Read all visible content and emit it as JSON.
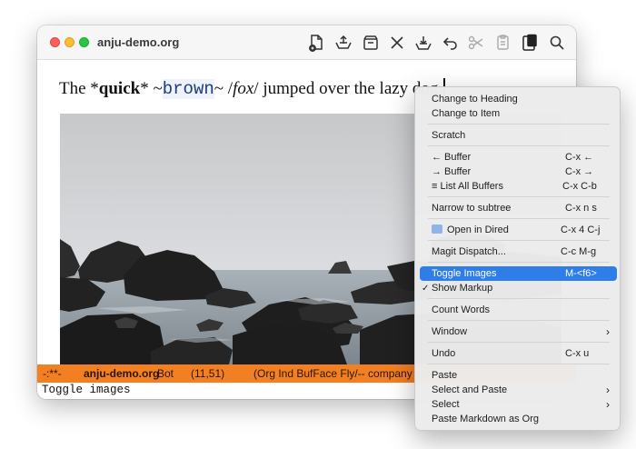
{
  "window": {
    "title": "anju-demo.org"
  },
  "toolbar": {
    "icons": [
      "new-file-icon",
      "upload-icon",
      "inbox-icon",
      "close-icon",
      "save-icon",
      "undo-icon",
      "cut-icon",
      "copy-icon",
      "paste-icon",
      "search-icon"
    ]
  },
  "editor": {
    "line_pre": "The *",
    "line_bold": "quick",
    "line_mid1": "* ~",
    "line_mono": "brown",
    "line_mid2": "~ /",
    "line_italic": "fox",
    "line_post": "/ jumped over the lazy dog."
  },
  "modeline": {
    "state": "-:**-",
    "buffer": "anju-demo.org",
    "position": "Bot",
    "linecol": "(11,51)",
    "modes": "(Org Ind BufFace Fly/-- company yas V"
  },
  "echo": "Toggle images",
  "menu": {
    "items": [
      {
        "label": "Change to Heading",
        "shortcut": ""
      },
      {
        "label": "Change to Item",
        "shortcut": ""
      },
      {
        "label": "Scratch",
        "shortcut": ""
      },
      {
        "label": "← Buffer",
        "shortcut": "C-x ←"
      },
      {
        "label": "→ Buffer",
        "shortcut": "C-x →"
      },
      {
        "label": "≡ List All Buffers",
        "shortcut": "C-x C-b"
      },
      {
        "label": "Narrow to subtree",
        "shortcut": "C-x n s"
      },
      {
        "label": "Open in Dired",
        "shortcut": "C-x 4 C-j"
      },
      {
        "label": "Magit Dispatch...",
        "shortcut": "C-c M-g"
      },
      {
        "label": "Toggle Images",
        "shortcut": "M-<f6>"
      },
      {
        "label": "Show Markup",
        "shortcut": ""
      },
      {
        "label": "Count Words",
        "shortcut": ""
      },
      {
        "label": "Window",
        "shortcut": ""
      },
      {
        "label": "Undo",
        "shortcut": "C-x u"
      },
      {
        "label": "Paste",
        "shortcut": ""
      },
      {
        "label": "Select and Paste",
        "shortcut": ""
      },
      {
        "label": "Select",
        "shortcut": ""
      },
      {
        "label": "Paste Markdown as Org",
        "shortcut": ""
      }
    ],
    "checkmark": "✓",
    "chevron": "›"
  },
  "colors": {
    "modeline_bg": "#f37f23",
    "menu_highlight": "#2f7de9"
  }
}
